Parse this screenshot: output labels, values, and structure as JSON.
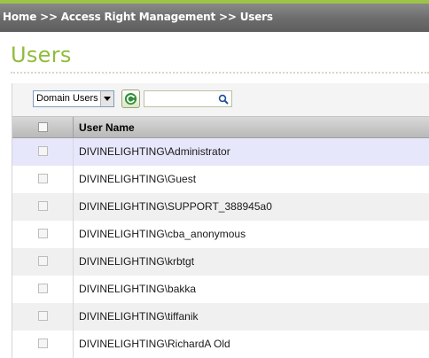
{
  "breadcrumb": "Home >> Access Right Management >> Users",
  "page_title": "Users",
  "toolbar": {
    "domain_select_value": "Domain Users",
    "refresh_icon": "refresh-icon",
    "search_value": "",
    "search_icon": "search-icon"
  },
  "table": {
    "column_header": "User Name",
    "rows": [
      "DIVINELIGHTING\\Administrator",
      "DIVINELIGHTING\\Guest",
      "DIVINELIGHTING\\SUPPORT_388945a0",
      "DIVINELIGHTING\\cba_anonymous",
      "DIVINELIGHTING\\krbtgt",
      "DIVINELIGHTING\\bakka",
      "DIVINELIGHTING\\tiffanik",
      "DIVINELIGHTING\\RichardA Old"
    ]
  },
  "colors": {
    "accent_green": "#8fbd3a",
    "header_bar": "#6e6e6e",
    "selected_row": "#e7e7fb"
  }
}
